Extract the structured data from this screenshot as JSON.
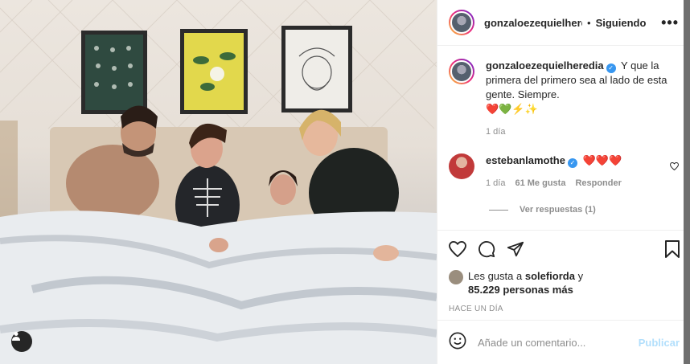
{
  "post": {
    "username": "gonzaloezequielheredia",
    "header_username": "gonzaloezequielhere",
    "follow_label": "Siguiendo",
    "separator": "•",
    "more_label": "•••",
    "caption_line1": "Y que la primera del primero sea al lado de esta gente. Siempre.",
    "caption_emoji": "❤️💚⚡✨",
    "caption_age": "1 día",
    "verified_mark": "✓"
  },
  "comments": [
    {
      "username": "estebanlamothe",
      "text": "❤️❤️❤️",
      "age": "1 día",
      "likes": "61 Me gusta",
      "reply_label": "Responder",
      "view_replies": "Ver respuestas (1)"
    }
  ],
  "likes": {
    "prefix": "Les gusta a",
    "first_user": "solefiorda",
    "joiner": "y",
    "count_text": "85.229 personas más"
  },
  "timestamp": "HACE UN DÍA",
  "composer": {
    "placeholder": "Añade un comentario...",
    "post_label": "Publicar"
  },
  "icons": {
    "like": "heart-icon",
    "comment": "comment-icon",
    "share": "share-icon",
    "save": "bookmark-icon",
    "emoji": "emoji-icon",
    "tag": "user-tag-icon",
    "comment_like": "heart-icon"
  },
  "colors": {
    "verified": "#3897f0",
    "post_disabled": "#b2dffc",
    "muted": "#8e8e8e"
  }
}
